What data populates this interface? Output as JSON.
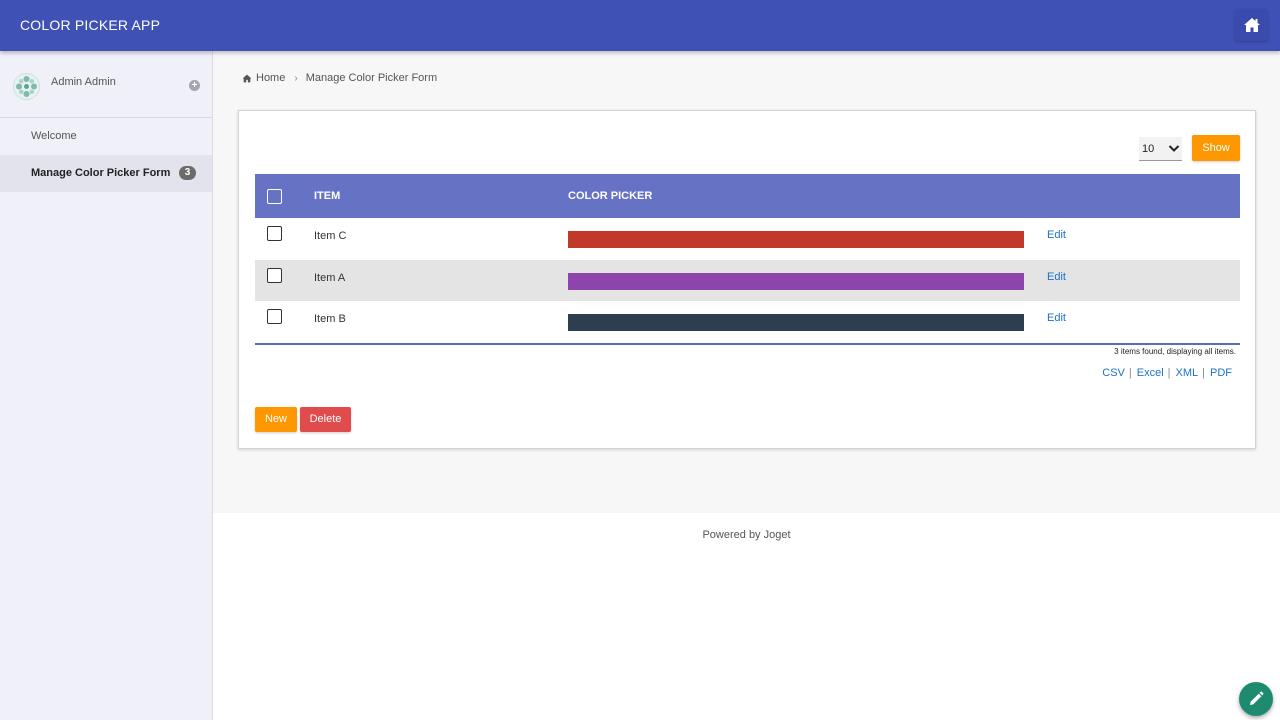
{
  "header": {
    "app_title": "COLOR PICKER APP",
    "home_icon": "home-icon"
  },
  "sidebar": {
    "profile": {
      "name": "Admin Admin",
      "toggle_icon": "plus-circle-icon"
    },
    "items": [
      {
        "label": "Welcome",
        "active": false
      },
      {
        "label": "Manage Color Picker Form",
        "active": true,
        "badge": "3"
      }
    ]
  },
  "breadcrumb": {
    "home": "Home",
    "current": "Manage Color Picker Form"
  },
  "list": {
    "page_size": "10",
    "show_label": "Show",
    "columns": [
      "ITEM",
      "COLOR PICKER"
    ],
    "rows": [
      {
        "item": "Item C",
        "color": "#c0392b",
        "action": "Edit"
      },
      {
        "item": "Item A",
        "color": "#8e44ad",
        "action": "Edit"
      },
      {
        "item": "Item B",
        "color": "#2c3e50",
        "action": "Edit"
      }
    ],
    "found_text": "3 items found, displaying all items.",
    "exports": [
      "CSV",
      "Excel",
      "XML",
      "PDF"
    ],
    "new_label": "New",
    "delete_label": "Delete"
  },
  "footer": {
    "text": "Powered by Joget"
  },
  "colors": {
    "primary": "#3f51b5",
    "table_header": "#6673c4",
    "accent": "#ff9800",
    "danger": "#e04b4b",
    "link": "#1a73c8",
    "fab": "#1e8a6e"
  }
}
